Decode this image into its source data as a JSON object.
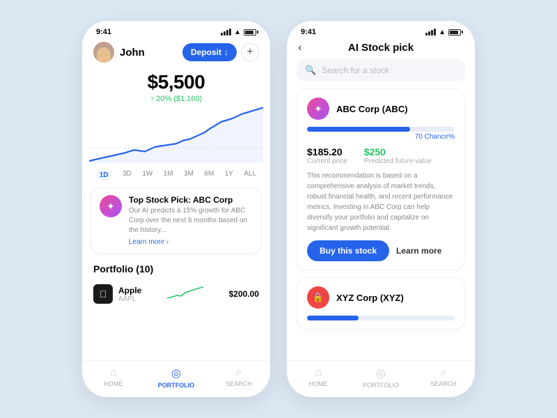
{
  "phone1": {
    "status": {
      "time": "9:41"
    },
    "header": {
      "user_name": "John",
      "deposit_label": "Deposit",
      "deposit_arrow": "↓",
      "plus": "+"
    },
    "balance": {
      "amount": "$5,500",
      "change": "↑ 20% ($1,160)"
    },
    "chart_tabs": [
      "1D",
      "3D",
      "1W",
      "1M",
      "3M",
      "6M",
      "1Y",
      "ALL"
    ],
    "active_tab": "1D",
    "stock_pick": {
      "title": "Top Stock Pick: ABC Corp",
      "description": "Our AI predicts a 15% growth for ABC Corp over the next 6 months based on the history...",
      "learn_more": "Learn more ›"
    },
    "portfolio": {
      "title": "Portfolio (10)",
      "items": [
        {
          "name": "Apple",
          "ticker": "AAPL",
          "value": "$200.00"
        }
      ]
    },
    "nav": {
      "items": [
        "HOME",
        "PORTFOLIO",
        "SEARCH"
      ],
      "active": "PORTFOLIO"
    }
  },
  "phone2": {
    "status": {
      "time": "9:41"
    },
    "header": {
      "back": "‹",
      "title": "AI Stock pick"
    },
    "search": {
      "placeholder": "Search for a stock",
      "icon": "🔍"
    },
    "abc_card": {
      "name": "ABC Corp (ABC)",
      "progress": 70,
      "chance_label": "70 Chance%",
      "current_price": "$185.20",
      "current_price_label": "Current price",
      "predicted_value": "$250",
      "predicted_value_label": "Predicted future value",
      "description": "This recommendation is based on a comprehensive analysis of market trends, robust financial health, and recent performance metrics. Investing in ABC Corp can help diversify your portfolio and capitalize on significant growth potential.",
      "buy_label": "Buy this stock",
      "learn_label": "Learn more"
    },
    "xyz_card": {
      "name": "XYZ Corp (XYZ)",
      "progress": 35
    },
    "nav": {
      "items": [
        "HOME",
        "PORTFOLIO",
        "SEARCH"
      ],
      "active": ""
    }
  },
  "colors": {
    "blue": "#2563eb",
    "green": "#22c55e",
    "pink": "#ec4899",
    "red": "#ef4444"
  }
}
